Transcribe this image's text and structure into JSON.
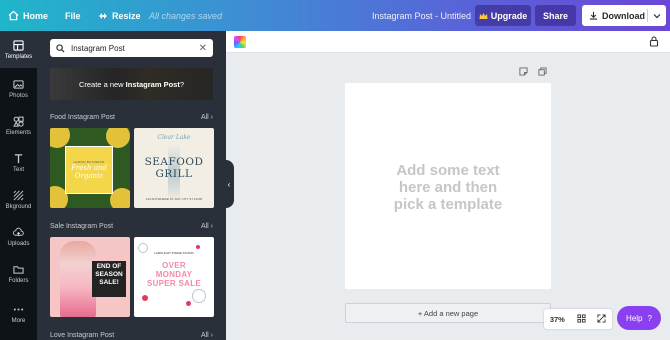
{
  "topbar": {
    "home": "Home",
    "file": "File",
    "resize": "Resize",
    "saved_status": "All changes saved",
    "doc_title": "Instagram Post - Untitled",
    "upgrade": "Upgrade",
    "share": "Share",
    "download": "Download"
  },
  "rail": {
    "items": [
      {
        "label": "Templates",
        "icon": "templates-icon"
      },
      {
        "label": "Photos",
        "icon": "photos-icon"
      },
      {
        "label": "Elements",
        "icon": "elements-icon"
      },
      {
        "label": "Text",
        "icon": "text-icon"
      },
      {
        "label": "Bkground",
        "icon": "background-icon"
      },
      {
        "label": "Uploads",
        "icon": "uploads-icon"
      },
      {
        "label": "Folders",
        "icon": "folders-icon"
      },
      {
        "label": "More",
        "icon": "more-icon"
      }
    ]
  },
  "panel": {
    "search_value": "Instagram Post",
    "create_new_prefix": "Create a new ",
    "create_new_bold": "Instagram Post",
    "create_new_suffix": "?",
    "sections": [
      {
        "title": "Food Instagram Post",
        "all": "All"
      },
      {
        "title": "Sale Instagram Post",
        "all": "All"
      },
      {
        "title": "Love Instagram Post",
        "all": "All"
      }
    ],
    "thumbs": {
      "food1_small": "LEMON BUSINESS",
      "food1_script": "Fresh and Organic",
      "food2_script": "Clear Lake",
      "food2_big1": "SEAFOOD",
      "food2_big2": "GRILL",
      "food2_tiny": "123 ANYWHERE ST. ANY CITY ST 12345",
      "sale1_label1": "END OF",
      "sale1_label2": "SEASON",
      "sale1_label3": "SALE!",
      "sale2_tiny": "LARSLIGHT INSIDE STUDIO",
      "sale2_pink1": "OVER",
      "sale2_pink2": "MONDAY",
      "sale2_pink3": "SUPER SALE"
    }
  },
  "canvas": {
    "hint_line1": "Add some text",
    "hint_line2": "here and then",
    "hint_line3": "pick a template",
    "add_page": "+ Add a new page"
  },
  "zoom": "37%",
  "help": "Help",
  "help_icon": "?",
  "colors": {
    "accent_purple": "#8a3ff0",
    "rail_bg": "#0e1318",
    "panel_bg": "#293039"
  }
}
